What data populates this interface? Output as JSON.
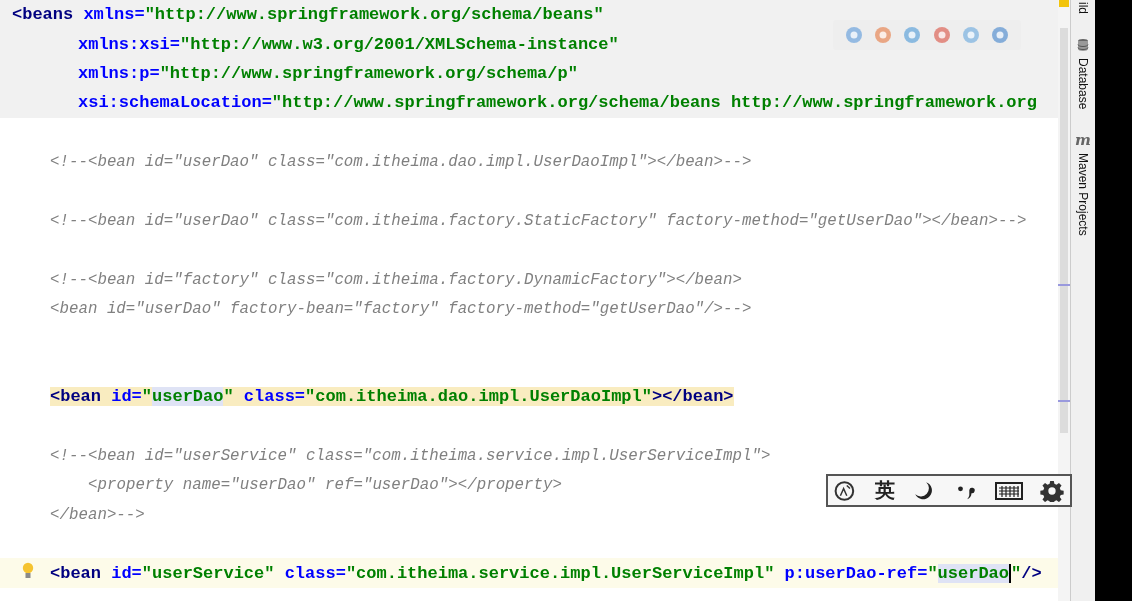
{
  "editor": {
    "lines": [
      {
        "kind": "header_start",
        "tokens": [
          {
            "kind": "tag",
            "s": "<beans"
          },
          {
            "kind": "attr",
            "s": " xmlns="
          },
          {
            "kind": "value",
            "s": "\"http://www.springframework.org/schema/beans\""
          }
        ]
      },
      {
        "kind": "header_attr",
        "tokens": [
          {
            "kind": "attr",
            "s": "xmlns:xsi="
          },
          {
            "kind": "value",
            "s": "\"http://www.w3.org/2001/XMLSchema-instance\""
          }
        ]
      },
      {
        "kind": "header_attr",
        "tokens": [
          {
            "kind": "attr",
            "s": "xmlns:p="
          },
          {
            "kind": "value",
            "s": "\"http://www.springframework.org/schema/p\""
          }
        ]
      },
      {
        "kind": "header_attr",
        "tokens": [
          {
            "kind": "attr",
            "s": "xsi:schemaLocation="
          },
          {
            "kind": "value",
            "s": "\"http://www.springframework.org/schema/beans http://www.springframework.org"
          }
        ]
      },
      {
        "kind": "blank"
      },
      {
        "kind": "code",
        "tokens": [
          {
            "kind": "comment",
            "s": "<!--<bean id=\"userDao\" class=\"com.itheima.dao.impl.UserDaoImpl\"></bean>-->"
          }
        ]
      },
      {
        "kind": "blank"
      },
      {
        "kind": "code",
        "tokens": [
          {
            "kind": "comment",
            "s": "<!--<bean id=\"userDao\" class=\"com.itheima.factory.StaticFactory\" factory-method=\"getUserDao\"></bean>-->"
          }
        ]
      },
      {
        "kind": "blank"
      },
      {
        "kind": "code",
        "tokens": [
          {
            "kind": "comment",
            "s": "<!--<bean id=\"factory\" class=\"com.itheima.factory.DynamicFactory\"></bean>"
          }
        ]
      },
      {
        "kind": "code",
        "tokens": [
          {
            "kind": "comment",
            "s": "<bean id=\"userDao\" factory-bean=\"factory\" factory-method=\"getUserDao\"/>-->"
          }
        ]
      },
      {
        "kind": "blank"
      },
      {
        "kind": "blank"
      },
      {
        "kind": "code",
        "tag_match": true,
        "tokens": [
          {
            "kind": "tag",
            "s": "<bean"
          },
          {
            "kind": "attr",
            "s": " id="
          },
          {
            "kind": "value",
            "s": "\""
          },
          {
            "kind": "value",
            "s": "userDao",
            "highlight": true
          },
          {
            "kind": "value",
            "s": "\""
          },
          {
            "kind": "attr",
            "s": " class="
          },
          {
            "kind": "value",
            "s": "\"com.itheima.dao.impl.UserDaoImpl\""
          },
          {
            "kind": "tag",
            "s": "></bean>"
          }
        ]
      },
      {
        "kind": "blank"
      },
      {
        "kind": "code",
        "tokens": [
          {
            "kind": "comment",
            "s": "<!--<bean id=\"userService\" class=\"com.itheima.service.impl.UserServiceImpl\">"
          }
        ]
      },
      {
        "kind": "nested",
        "tokens": [
          {
            "kind": "comment",
            "s": "<property name=\"userDao\" ref=\"userDao\"></property>"
          }
        ]
      },
      {
        "kind": "code",
        "tokens": [
          {
            "kind": "comment",
            "s": "</bean>-->"
          }
        ]
      },
      {
        "kind": "blank"
      },
      {
        "kind": "caret",
        "intention": true,
        "tokens": [
          {
            "kind": "tag",
            "s": "<bean"
          },
          {
            "kind": "attr",
            "s": " id="
          },
          {
            "kind": "value",
            "s": "\"userService\""
          },
          {
            "kind": "attr",
            "s": " class="
          },
          {
            "kind": "value",
            "s": "\"com.itheima.service.impl.UserServiceImpl\""
          },
          {
            "kind": "attr",
            "s": " p:userDao-ref="
          },
          {
            "kind": "value",
            "s": "\""
          },
          {
            "kind": "value",
            "s": "userDao",
            "highlight": true,
            "caret": true
          },
          {
            "kind": "value",
            "s": "\""
          },
          {
            "kind": "tag",
            "s": "/>"
          }
        ]
      }
    ]
  },
  "tool_windows": [
    {
      "kind": "plain",
      "label": "ild"
    },
    {
      "kind": "database",
      "label": "Database"
    },
    {
      "kind": "maven",
      "glyph": "m",
      "label": "Maven Projects"
    }
  ],
  "ime_bar": {
    "mode": "英"
  }
}
